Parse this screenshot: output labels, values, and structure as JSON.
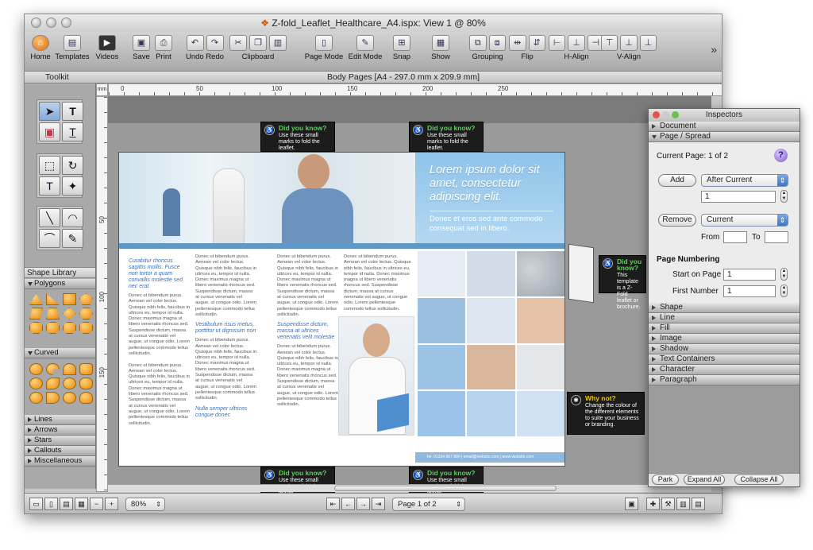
{
  "window": {
    "title": "Z-fold_Leaflet_Healthcare_A4.ispx: View 1 @ 80%"
  },
  "toolbar": {
    "home": "Home",
    "templates": "Templates",
    "videos": "Videos",
    "save": "Save",
    "print": "Print",
    "undo_redo": "Undo Redo",
    "clipboard": "Clipboard",
    "page_mode": "Page Mode",
    "edit_mode": "Edit Mode",
    "snap": "Snap",
    "show": "Show",
    "grouping": "Grouping",
    "flip": "Flip",
    "h_align": "H-Align",
    "v_align": "V-Align",
    "more_icon": "chevron-double-right-icon"
  },
  "subbar": {
    "toolkit": "Toolkit",
    "body_pages": "Body Pages   [A4 - 297.0 mm x 209.9 mm]"
  },
  "ruler": {
    "unit": "mm",
    "top_ticks": [
      "0",
      "50",
      "100",
      "150",
      "200",
      "250"
    ],
    "left_ticks": [
      "50",
      "100",
      "150"
    ]
  },
  "library": {
    "title": "Shape Library",
    "categories": [
      "Polygons",
      "Curved",
      "Lines",
      "Arrows",
      "Stars",
      "Callouts",
      "Miscellaneous"
    ]
  },
  "leaflet": {
    "headline": "Lorem ipsum dolor sit amet, consectetur adipiscing elit.",
    "subhead": "Donec et eros sed ante commodo consequat sed in libero.",
    "col1_head": "Curabitur rhoncus sagittis mollis. Fusce non tortor a quam convallis molestie sed nec erat.",
    "col2_head1": "Vestibulum risus metus, porttitor ut dignissim non",
    "col2_head2": "Vestibulum risus metus, porttitor ut dignissim non",
    "col2_head3": "Nulla semper ultrices congue donec",
    "col3_head": "Suspendisse dictum, massa at ultrices venenatis velit molestie",
    "body": "Donec ut bibendum purus. Aenean vel color lectus. Quisque nibh felis, faucibus in ultrices eu, tempor id nulla. Donec maximus magna ut libero venenatis rhoncus sed. Suspendisse dictum, massa at cursus venenatis vel augue, ut congue odio. Lorem pellentesque commodo tellus sollicitudin.",
    "footer": "Tel: 01234 567 890   |   email@website.com   |   www.website.com"
  },
  "tips": {
    "dyk_title": "Did you know?",
    "dyk_text": "Use these small marks to fold the leaflet.",
    "dyk_side_text": "This template is a Z-Fold leaflet or brochure.",
    "why_title": "Why not?",
    "why_text": "Change the colour of the different elements to suite your business or branding."
  },
  "inspector": {
    "title": "Inspectors",
    "sections_top": [
      "Document",
      "Page / Spread"
    ],
    "current_page": "Current Page: 1 of 2",
    "add": "Add",
    "after_current": "After Current",
    "add_count": "1",
    "remove": "Remove",
    "current": "Current",
    "from": "From",
    "to": "To",
    "page_numbering": "Page Numbering",
    "start_on_page": "Start on Page",
    "start_value": "1",
    "first_number": "First Number",
    "first_value": "1",
    "sections_bottom": [
      "Shape",
      "Line",
      "Fill",
      "Image",
      "Shadow",
      "Text Containers",
      "Character",
      "Paragraph"
    ],
    "park": "Park",
    "expand_all": "Expand All",
    "collapse_all": "Collapse All"
  },
  "statusbar": {
    "zoom": "80%",
    "page": "Page 1 of 2"
  },
  "colors": {
    "accent_blue": "#5f97c5",
    "panel_blue": "#8ec4ea",
    "tip_green": "#5fd05f",
    "tip_yellow": "#f2c400"
  }
}
